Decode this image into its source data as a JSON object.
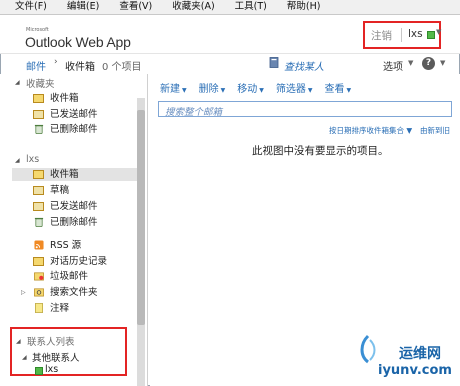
{
  "menu": [
    "文件(F)",
    "编辑(E)",
    "查看(V)",
    "收藏夹(A)",
    "工具(T)",
    "帮助(H)"
  ],
  "header": {
    "logo_small": "Microsoft",
    "logo": "Outlook Web App",
    "signout": "注销",
    "user": "lxs"
  },
  "breadcrumb": {
    "mail": "邮件",
    "sep": "›",
    "inbox": "收件箱",
    "count": "0 个项目",
    "find_people": "查找某人",
    "options": "选项",
    "help": "?"
  },
  "nav": {
    "favorites_title": "收藏夹",
    "favorites": [
      "收件箱",
      "已发送邮件",
      "已删除邮件"
    ],
    "mailbox_title": "lxs",
    "mailbox": [
      "收件箱",
      "草稿",
      "已发送邮件",
      "已删除邮件"
    ],
    "other": [
      "RSS 源",
      "对话历史记录",
      "垃圾邮件",
      "搜索文件夹",
      "注释"
    ],
    "contacts_title": "联系人列表",
    "contacts_group": "其他联系人",
    "contact": "lxs"
  },
  "toolbar": [
    "新建",
    "删除",
    "移动",
    "筛选器",
    "查看"
  ],
  "search": {
    "placeholder": "搜索整个邮箱"
  },
  "sort": {
    "by": "按日期排序收件箱集合",
    "order": "由新到旧"
  },
  "empty_message": "此视图中没有要显示的项目。",
  "watermark": {
    "name": "运维网",
    "url": "iyunv.com"
  },
  "colors": {
    "accent": "#2b6fb6",
    "highlight_box": "#e32424",
    "presence": "#52b848"
  }
}
